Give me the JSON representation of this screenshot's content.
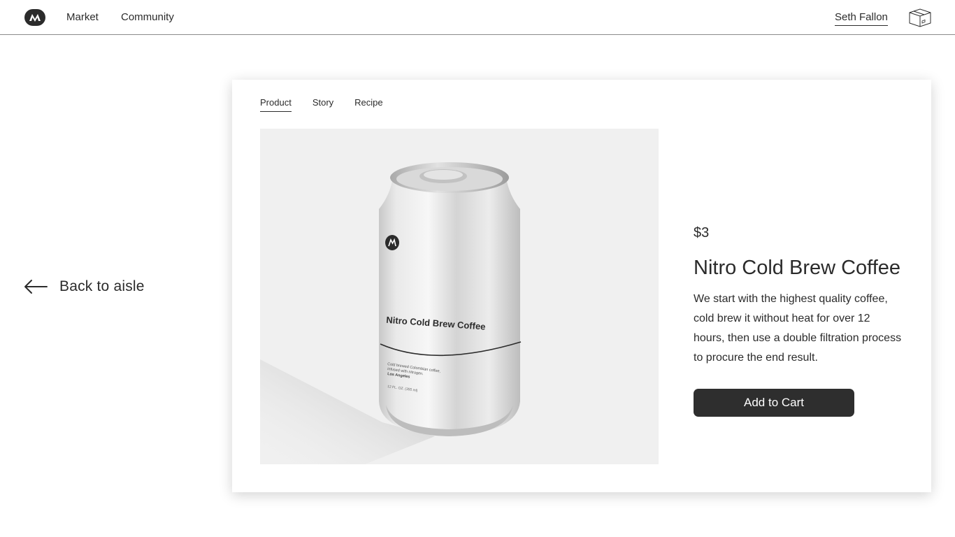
{
  "brand": {
    "logo_letter": "M"
  },
  "nav": {
    "market": "Market",
    "community": "Community",
    "user": "Seth Fallon"
  },
  "back": {
    "label": "Back to aisle"
  },
  "tabs": [
    "Product",
    "Story",
    "Recipe"
  ],
  "product": {
    "price": "$3",
    "name": "Nitro Cold Brew Coffee",
    "description": "We start with the highest quality coffee, cold brew it without heat for over 12 hours, then use a double filtration process to procure the end result.",
    "add_to_cart": "Add to Cart",
    "can_label": "Nitro Cold Brew Coffee",
    "can_small_1": "Cold brewed Colombian coffee,",
    "can_small_2": "infused with nitrogen.",
    "can_small_3": "Los Angeles",
    "can_volume": "12 FL. OZ. (355 ml)"
  },
  "colors": {
    "ink": "#2b2b2b",
    "card_bg": "#ffffff",
    "image_bg": "#f0f0f0",
    "button": "#2e2e2e"
  },
  "icons": {
    "logo": "brand-logo-icon",
    "cart": "box-icon",
    "back": "arrow-left-icon"
  }
}
